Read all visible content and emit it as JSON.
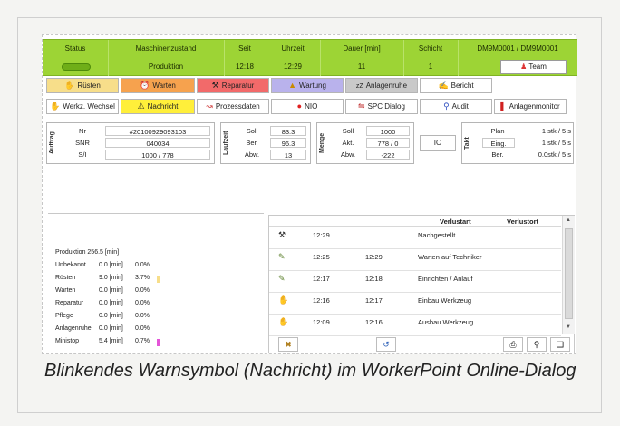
{
  "statusbar": {
    "headers": [
      "Status",
      "Maschinenzustand",
      "Seit",
      "Uhrzeit",
      "Dauer [min]",
      "Schicht",
      "DM9M0001 / DM9M0001"
    ],
    "values": {
      "maschinenzustand": "Produktion",
      "seit": "12:18",
      "uhrzeit": "12:29",
      "dauer": "11",
      "schicht": "1"
    },
    "status_color": "#6fae18",
    "team_label": "Team"
  },
  "buttons_row1": [
    {
      "label": "Rüsten",
      "icon": "hand-icon",
      "color": "#f7de8a"
    },
    {
      "label": "Warten",
      "icon": "alarm-icon",
      "color": "#f6a24e"
    },
    {
      "label": "Reparatur",
      "icon": "tools-icon",
      "color": "#f26a6a"
    },
    {
      "label": "Wartung",
      "icon": "oil-can-icon",
      "color": "#b9b2ec"
    },
    {
      "label": "Anlagenruhe",
      "icon": "sleep-icon",
      "color": "#c9c9c9"
    },
    {
      "label": "Bericht",
      "icon": "report-icon",
      "color": "#ffffff"
    }
  ],
  "buttons_row2": [
    {
      "label": "Werkz. Wechsel",
      "icon": "hand-icon"
    },
    {
      "label": "Nachricht",
      "icon": "warning-icon",
      "color": "#ffef3a"
    },
    {
      "label": "Prozessdaten",
      "icon": "chart-icon"
    },
    {
      "label": "NIO",
      "icon": "red-dot-icon"
    },
    {
      "label": "SPC Dialog",
      "icon": "spc-icon"
    },
    {
      "label": "Audit",
      "icon": "pin-icon"
    },
    {
      "label": "Anlagenmonitor",
      "icon": "thermometer-icon"
    }
  ],
  "auftrag": {
    "label": "Auftrag",
    "rows": [
      {
        "key": "Nr",
        "value": "#20100929093103"
      },
      {
        "key": "SNR",
        "value": "040034"
      },
      {
        "key": "S/I",
        "value": "1000 / 778"
      }
    ]
  },
  "laufzeit": {
    "label": "Laufzeit",
    "rows": [
      {
        "key": "Soll",
        "value": "83.3"
      },
      {
        "key": "Ber.",
        "value": "96.3"
      },
      {
        "key": "Abw.",
        "value": "13"
      }
    ]
  },
  "menge": {
    "label": "Menge",
    "rows": [
      {
        "key": "Soll",
        "value": "1000"
      },
      {
        "key": "Akt.",
        "value": "778 / 0"
      },
      {
        "key": "Abw.",
        "value": "-222"
      }
    ]
  },
  "io_label": "IO",
  "takt": {
    "label": "Takt",
    "rows": [
      {
        "key": "Plan",
        "value": "1 stk / 5 s"
      },
      {
        "key": "Eing.",
        "value": "1 stk / 5 s"
      },
      {
        "key": "Ber.",
        "value": "0.0stk / 5 s"
      }
    ]
  },
  "stats": {
    "produktion": "Produktion  256.5 [min]",
    "rows": [
      {
        "label": "Unbekannt",
        "value": "0.0 [min]",
        "pct": "0.0%",
        "bar": 0,
        "color": ""
      },
      {
        "label": "Rüsten",
        "value": "9.0 [min]",
        "pct": "3.7%",
        "bar": 1,
        "color": "#f7de8a"
      },
      {
        "label": "Warten",
        "value": "0.0 [min]",
        "pct": "0.0%",
        "bar": 0,
        "color": ""
      },
      {
        "label": "Reparatur",
        "value": "0.0 [min]",
        "pct": "0.0%",
        "bar": 0,
        "color": ""
      },
      {
        "label": "Pflege",
        "value": "0.0 [min]",
        "pct": "0.0%",
        "bar": 0,
        "color": ""
      },
      {
        "label": "Anlagenruhe",
        "value": "0.0 [min]",
        "pct": "0.0%",
        "bar": 0,
        "color": ""
      },
      {
        "label": "Ministop",
        "value": "5.4 [min]",
        "pct": "0.7%",
        "bar": 1,
        "color": "#e455d8"
      }
    ]
  },
  "events": {
    "headers": {
      "verlustart": "Verlustart",
      "verlustort": "Verlustort"
    },
    "rows": [
      {
        "icon": "tools-icon",
        "glyph": "⚒",
        "start": "12:29",
        "end": "",
        "text": "Nachgestellt"
      },
      {
        "icon": "worker-icon",
        "glyph": "✎",
        "start": "12:25",
        "end": "12:29",
        "text": "Warten auf Techniker"
      },
      {
        "icon": "worker-icon",
        "glyph": "✎",
        "start": "12:17",
        "end": "12:18",
        "text": "Einrichten / Anlauf"
      },
      {
        "icon": "hand-icon",
        "glyph": "✋",
        "start": "12:16",
        "end": "12:17",
        "text": "Einbau Werkzeug"
      },
      {
        "icon": "hand-icon",
        "glyph": "✋",
        "start": "12:09",
        "end": "12:16",
        "text": "Ausbau Werkzeug"
      }
    ]
  },
  "caption": "Blinkendes Warnsymbol (Nachricht) im WorkerPoint Online-Dialog"
}
